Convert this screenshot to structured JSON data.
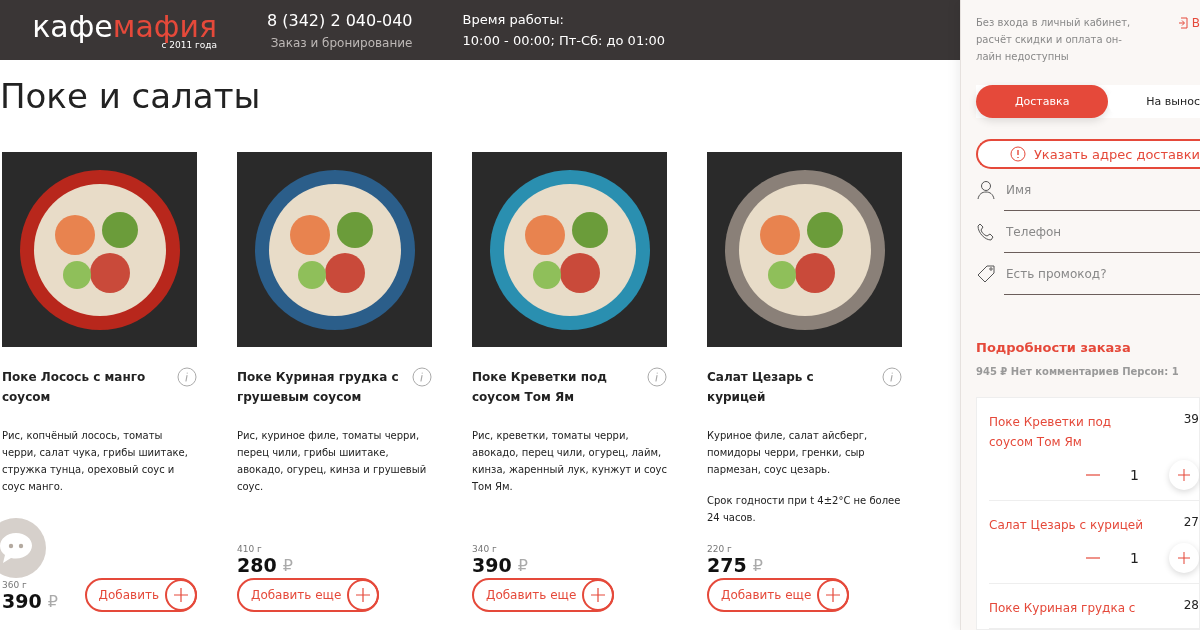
{
  "header": {
    "logo": {
      "part_1": "кафе",
      "part_2": "мафия",
      "since": "с 2011 года"
    },
    "phone": "8 (342) 2 040-040",
    "phone_caption": "Заказ и бронирование",
    "hours_title": "Время работы:",
    "hours": "10:00 - 00:00; Пт-Сб: до 01:00"
  },
  "page_title": "Поке и салаты",
  "products": [
    {
      "name": "Поке Лосось с манго соусом",
      "description": [
        "Рис, копчёный лосось, томаты черри, салат чука, грибы шиитаке, стружка тунца, ореховый соус и соус манго."
      ],
      "weight": "360 г",
      "price": "390",
      "currency": "₽",
      "button": "Добавить",
      "in_cart": false
    },
    {
      "name": "Поке Куриная грудка с грушевым соусом",
      "description": [
        "Рис, куриное филе, томаты черри, перец чили, грибы шиитаке, авокадо, огурец, кинза и грушевый соус."
      ],
      "weight": "410 г",
      "price": "280",
      "currency": "₽",
      "button": "Добавить еще",
      "in_cart": true
    },
    {
      "name": "Поке Креветки под соусом Том Ям",
      "description": [
        "Рис, креветки, томаты черри, авокадо, перец чили, огурец, лайм, кинза, жаренный лук, кунжут и соус Том Ям."
      ],
      "weight": "340 г",
      "price": "390",
      "currency": "₽",
      "button": "Добавить еще",
      "in_cart": true
    },
    {
      "name": "Салат Цезарь с курицей",
      "description": [
        "Куриное филе, салат айсберг, помидоры черри, гренки, сыр пармезан, соус цезарь.",
        "Срок годности при t 4±2°C не более 24 часов."
      ],
      "weight": "220 г",
      "price": "275",
      "currency": "₽",
      "button": "Добавить еще",
      "in_cart": true
    }
  ],
  "cart": {
    "notice": "Без входа в личный кабинет, расчёт скидки и оплата он-лайн недоступны",
    "login": "В",
    "tabs": [
      {
        "label": "Доставка",
        "selected": true
      },
      {
        "label": "На вынос",
        "selected": false
      }
    ],
    "address_button": "Указать адрес доставки",
    "fields": [
      {
        "kind": "person",
        "placeholder": "Имя"
      },
      {
        "kind": "phone",
        "placeholder": "Телефон"
      },
      {
        "kind": "promo",
        "placeholder": "Есть промокод?"
      }
    ],
    "details_title": "Подробности заказа",
    "summary": "945 ₽ Нет комментариев Персон: 1",
    "items": [
      {
        "name": "Поке Креветки под соусом Том Ям",
        "price": "39",
        "qty": "1"
      },
      {
        "name": "Салат Цезарь с курицей",
        "price": "27",
        "qty": "1"
      },
      {
        "name": "Поке Куриная грудка с",
        "price": "28"
      }
    ]
  }
}
